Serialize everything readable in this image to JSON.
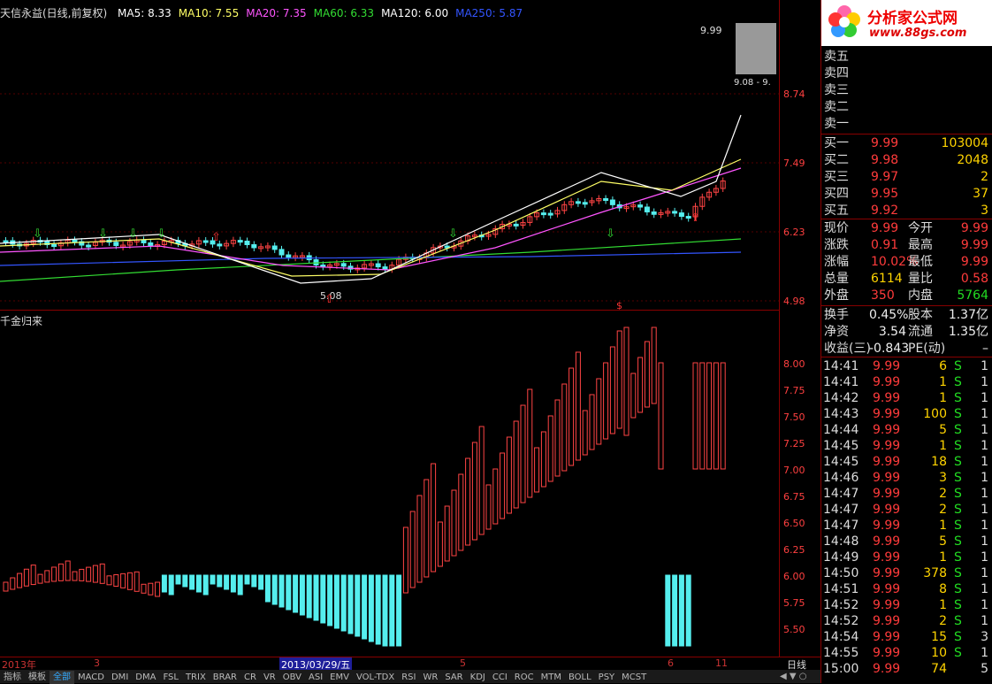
{
  "main": {
    "stock_title": "天信永益(日线,前复权)",
    "ma": [
      {
        "label": "MA5: 8.33",
        "color": "#ffffff"
      },
      {
        "label": "MA10: 7.55",
        "color": "#ffff66"
      },
      {
        "label": "MA20: 7.35",
        "color": "#ff55ff"
      },
      {
        "label": "MA60: 6.33",
        "color": "#33dd33"
      },
      {
        "label": "MA120: 6.00",
        "color": "#ffffff"
      },
      {
        "label": "MA250: 5.87",
        "color": "#3355ff"
      }
    ],
    "y_labels": [
      "8.74",
      "7.49",
      "6.23",
      "4.98"
    ],
    "high_label": "9.99",
    "low_label": "5.08",
    "range_label": "9.08 - 9.",
    "dollar_mark": "$"
  },
  "sub": {
    "indicator_title": "千金归来",
    "y_labels": [
      "8.00",
      "7.75",
      "7.50",
      "7.25",
      "7.00",
      "6.75",
      "6.50",
      "6.25",
      "6.00",
      "5.75",
      "5.50"
    ]
  },
  "timebar": {
    "labels": [
      {
        "text": "2013年"
      },
      {
        "text": "3"
      },
      {
        "text": "2013/03/29/五"
      },
      {
        "text": "5"
      },
      {
        "text": "6"
      },
      {
        "text": "11"
      }
    ],
    "period": "日线"
  },
  "tabs": [
    "指标",
    "模板",
    "全部",
    "MACD",
    "DMI",
    "DMA",
    "FSL",
    "TRIX",
    "BRAR",
    "CR",
    "VR",
    "OBV",
    "ASI",
    "EMV",
    "VOL-TDX",
    "RSI",
    "WR",
    "SAR",
    "KDJ",
    "CCI",
    "ROC",
    "MTM",
    "BOLL",
    "PSY",
    "MCST"
  ],
  "logo": {
    "title": "分析家公式网",
    "url": "www.88gs.com"
  },
  "orderbook": {
    "sell": [
      "卖五",
      "卖四",
      "卖三",
      "卖二",
      "卖一"
    ],
    "buy": [
      {
        "label": "买一",
        "price": "9.99",
        "vol": "103004"
      },
      {
        "label": "买二",
        "price": "9.98",
        "vol": "2048"
      },
      {
        "label": "买三",
        "price": "9.97",
        "vol": "2"
      },
      {
        "label": "买四",
        "price": "9.95",
        "vol": "37"
      },
      {
        "label": "买五",
        "price": "9.92",
        "vol": "3"
      }
    ]
  },
  "quote": [
    {
      "l1": "现价",
      "v1": "9.99",
      "c1": "red",
      "l2": "今开",
      "v2": "9.99",
      "c2": "red"
    },
    {
      "l1": "涨跌",
      "v1": "0.91",
      "c1": "red",
      "l2": "最高",
      "v2": "9.99",
      "c2": "red"
    },
    {
      "l1": "涨幅",
      "v1": "10.02%",
      "c1": "red",
      "l2": "最低",
      "v2": "9.99",
      "c2": "red"
    },
    {
      "l1": "总量",
      "v1": "6114",
      "c1": "yellow",
      "l2": "量比",
      "v2": "0.58",
      "c2": "red"
    },
    {
      "l1": "外盘",
      "v1": "350",
      "c1": "red",
      "l2": "内盘",
      "v2": "5764",
      "c2": "green"
    }
  ],
  "fundamentals": [
    {
      "l1": "换手",
      "v1": "0.45%",
      "l2": "股本",
      "v2": "1.37亿"
    },
    {
      "l1": "净资",
      "v1": "3.54",
      "l2": "流通",
      "v2": "1.35亿"
    },
    {
      "l1": "收益(三)",
      "v1": "-0.843",
      "l2": "PE(动)",
      "v2": "–"
    }
  ],
  "ticks": [
    {
      "t": "14:41",
      "p": "9.99",
      "v": "6",
      "bs": "S",
      "n": "1"
    },
    {
      "t": "14:41",
      "p": "9.99",
      "v": "1",
      "bs": "S",
      "n": "1"
    },
    {
      "t": "14:42",
      "p": "9.99",
      "v": "1",
      "bs": "S",
      "n": "1"
    },
    {
      "t": "14:43",
      "p": "9.99",
      "v": "100",
      "bs": "S",
      "n": "1"
    },
    {
      "t": "14:44",
      "p": "9.99",
      "v": "5",
      "bs": "S",
      "n": "1"
    },
    {
      "t": "14:45",
      "p": "9.99",
      "v": "1",
      "bs": "S",
      "n": "1"
    },
    {
      "t": "14:45",
      "p": "9.99",
      "v": "18",
      "bs": "S",
      "n": "1"
    },
    {
      "t": "14:46",
      "p": "9.99",
      "v": "3",
      "bs": "S",
      "n": "1"
    },
    {
      "t": "14:47",
      "p": "9.99",
      "v": "2",
      "bs": "S",
      "n": "1"
    },
    {
      "t": "14:47",
      "p": "9.99",
      "v": "2",
      "bs": "S",
      "n": "1"
    },
    {
      "t": "14:47",
      "p": "9.99",
      "v": "1",
      "bs": "S",
      "n": "1"
    },
    {
      "t": "14:48",
      "p": "9.99",
      "v": "5",
      "bs": "S",
      "n": "1"
    },
    {
      "t": "14:49",
      "p": "9.99",
      "v": "1",
      "bs": "S",
      "n": "1"
    },
    {
      "t": "14:50",
      "p": "9.99",
      "v": "378",
      "bs": "S",
      "n": "1"
    },
    {
      "t": "14:51",
      "p": "9.99",
      "v": "8",
      "bs": "S",
      "n": "1"
    },
    {
      "t": "14:52",
      "p": "9.99",
      "v": "1",
      "bs": "S",
      "n": "1"
    },
    {
      "t": "14:52",
      "p": "9.99",
      "v": "2",
      "bs": "S",
      "n": "1"
    },
    {
      "t": "14:54",
      "p": "9.99",
      "v": "15",
      "bs": "S",
      "n": "3"
    },
    {
      "t": "14:55",
      "p": "9.99",
      "v": "10",
      "bs": "S",
      "n": "1"
    },
    {
      "t": "15:00",
      "p": "9.99",
      "v": "74",
      "bs": "",
      "n": "5"
    }
  ]
}
